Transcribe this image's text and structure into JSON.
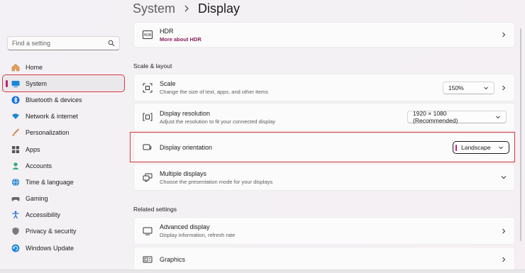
{
  "breadcrumb": {
    "parent": "System",
    "current": "Display"
  },
  "search": {
    "placeholder": "Find a setting"
  },
  "sidebar": {
    "items": [
      {
        "label": "Home",
        "icon": "home-icon"
      },
      {
        "label": "System",
        "icon": "system-icon",
        "active": true
      },
      {
        "label": "Bluetooth & devices",
        "icon": "bluetooth-icon"
      },
      {
        "label": "Network & internet",
        "icon": "wifi-icon"
      },
      {
        "label": "Personalization",
        "icon": "brush-icon"
      },
      {
        "label": "Apps",
        "icon": "apps-icon"
      },
      {
        "label": "Accounts",
        "icon": "account-icon"
      },
      {
        "label": "Time & language",
        "icon": "globe-clock-icon"
      },
      {
        "label": "Gaming",
        "icon": "gamepad-icon"
      },
      {
        "label": "Accessibility",
        "icon": "accessibility-icon"
      },
      {
        "label": "Privacy & security",
        "icon": "shield-icon"
      },
      {
        "label": "Windows Update",
        "icon": "update-icon"
      }
    ]
  },
  "main": {
    "hdr": {
      "title": "HDR",
      "link": "More about HDR"
    },
    "scale_layout_label": "Scale & layout",
    "scale": {
      "title": "Scale",
      "subtitle": "Change the size of text, apps, and other items",
      "value": "150%"
    },
    "resolution": {
      "title": "Display resolution",
      "subtitle": "Adjust the resolution to fit your connected display",
      "value": "1920 × 1080 (Recommended)"
    },
    "orientation": {
      "title": "Display orientation",
      "value": "Landscape"
    },
    "multiple": {
      "title": "Multiple displays",
      "subtitle": "Choose the presentation mode for your displays"
    },
    "related_label": "Related settings",
    "advanced": {
      "title": "Advanced display",
      "subtitle": "Display information, refresh rate"
    },
    "graphics": {
      "title": "Graphics"
    }
  },
  "colors": {
    "accent": "#c4216f",
    "highlight": "#d93a3a",
    "link": "#8a1f5a"
  }
}
